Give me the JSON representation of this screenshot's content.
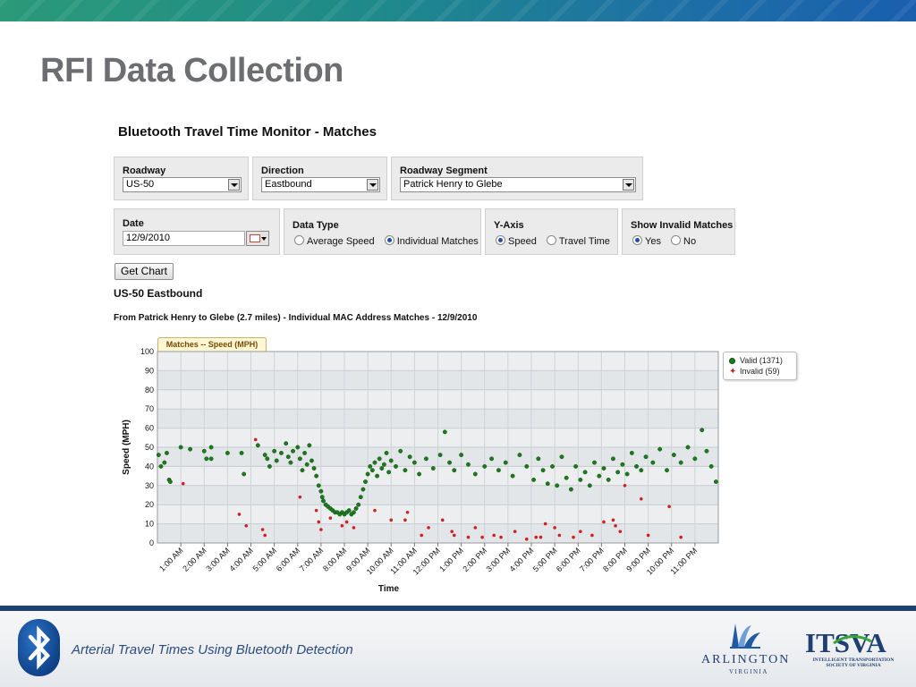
{
  "slide_title": "RFI Data Collection",
  "app_title": "Bluetooth Travel Time Monitor - Matches",
  "form": {
    "roadway": {
      "label": "Roadway",
      "value": "US-50"
    },
    "direction": {
      "label": "Direction",
      "value": "Eastbound"
    },
    "segment": {
      "label": "Roadway Segment",
      "value": "Patrick Henry to Glebe"
    },
    "date": {
      "label": "Date",
      "value": "12/9/2010"
    },
    "data_type": {
      "label": "Data Type",
      "options": [
        "Average Speed",
        "Individual Matches"
      ],
      "selected": "Individual Matches"
    },
    "y_axis": {
      "label": "Y-Axis",
      "options": [
        "Speed",
        "Travel Time"
      ],
      "selected": "Speed"
    },
    "invalid": {
      "label": "Show Invalid Matches",
      "options": [
        "Yes",
        "No"
      ],
      "selected": "Yes"
    },
    "get_chart": "Get Chart"
  },
  "route_title": "US-50 Eastbound",
  "chart_subtitle": "From Patrick Henry to Glebe (2.7 miles) - Individual MAC Address Matches - 12/9/2010",
  "chart_tab": "Matches -- Speed (MPH)",
  "legend": {
    "valid": "Valid (1371)",
    "invalid": "Invalid (59)"
  },
  "chart_data": {
    "type": "scatter",
    "title": "Matches -- Speed (MPH)",
    "xlabel": "Time",
    "ylabel": "Speed (MPH)",
    "xlim": [
      0,
      24
    ],
    "ylim": [
      0,
      100
    ],
    "yticks": [
      0,
      10,
      20,
      30,
      40,
      50,
      60,
      70,
      80,
      90,
      100
    ],
    "xticks": [
      1,
      2,
      3,
      4,
      5,
      6,
      7,
      8,
      9,
      10,
      11,
      12,
      13,
      14,
      15,
      16,
      17,
      18,
      19,
      20,
      21,
      22,
      23
    ],
    "xtick_labels": [
      "1:00 AM",
      "2:00 AM",
      "3:00 AM",
      "4:00 AM",
      "5:00 AM",
      "6:00 AM",
      "7:00 AM",
      "8:00 AM",
      "9:00 AM",
      "10:00 AM",
      "11:00 AM",
      "12:00 PM",
      "1:00 PM",
      "2:00 PM",
      "3:00 PM",
      "4:00 PM",
      "5:00 PM",
      "6:00 PM",
      "7:00 PM",
      "8:00 PM",
      "9:00 PM",
      "10:00 PM",
      "11:00 PM"
    ],
    "grid": true,
    "legend_position": "top-right",
    "series": [
      {
        "name": "Valid (1371)",
        "color": "#1d7a1d",
        "marker": "circle",
        "points": [
          [
            0.05,
            46
          ],
          [
            0.15,
            40
          ],
          [
            0.3,
            42
          ],
          [
            0.4,
            47
          ],
          [
            0.5,
            33
          ],
          [
            0.55,
            32
          ],
          [
            1.0,
            50
          ],
          [
            1.4,
            49
          ],
          [
            2.0,
            48
          ],
          [
            2.1,
            44
          ],
          [
            2.3,
            50
          ],
          [
            2.3,
            44
          ],
          [
            3.0,
            47
          ],
          [
            3.6,
            47
          ],
          [
            3.7,
            36
          ],
          [
            4.3,
            51
          ],
          [
            4.6,
            46
          ],
          [
            4.7,
            44
          ],
          [
            4.8,
            40
          ],
          [
            5.0,
            48
          ],
          [
            5.1,
            43
          ],
          [
            5.3,
            47
          ],
          [
            5.5,
            52
          ],
          [
            5.6,
            45
          ],
          [
            5.7,
            42
          ],
          [
            5.8,
            48
          ],
          [
            6.0,
            50
          ],
          [
            6.1,
            44
          ],
          [
            6.2,
            38
          ],
          [
            6.3,
            47
          ],
          [
            6.4,
            41
          ],
          [
            6.5,
            51
          ],
          [
            6.6,
            43
          ],
          [
            6.7,
            39
          ],
          [
            6.8,
            35
          ],
          [
            6.9,
            30
          ],
          [
            7.0,
            27
          ],
          [
            7.05,
            24
          ],
          [
            7.1,
            22
          ],
          [
            7.2,
            20
          ],
          [
            7.3,
            19
          ],
          [
            7.4,
            18
          ],
          [
            7.5,
            17
          ],
          [
            7.6,
            16
          ],
          [
            7.7,
            16
          ],
          [
            7.8,
            15
          ],
          [
            7.9,
            16
          ],
          [
            8.0,
            15
          ],
          [
            8.1,
            16
          ],
          [
            8.2,
            17
          ],
          [
            8.3,
            15
          ],
          [
            8.4,
            16
          ],
          [
            8.5,
            18
          ],
          [
            8.6,
            20
          ],
          [
            8.7,
            24
          ],
          [
            8.8,
            28
          ],
          [
            8.9,
            32
          ],
          [
            9.0,
            36
          ],
          [
            9.1,
            40
          ],
          [
            9.2,
            38
          ],
          [
            9.3,
            42
          ],
          [
            9.4,
            35
          ],
          [
            9.5,
            44
          ],
          [
            9.6,
            39
          ],
          [
            9.7,
            41
          ],
          [
            9.8,
            47
          ],
          [
            9.9,
            37
          ],
          [
            10.0,
            43
          ],
          [
            10.2,
            40
          ],
          [
            10.4,
            48
          ],
          [
            10.6,
            38
          ],
          [
            10.8,
            45
          ],
          [
            11.0,
            42
          ],
          [
            11.2,
            36
          ],
          [
            11.5,
            44
          ],
          [
            11.8,
            39
          ],
          [
            12.1,
            46
          ],
          [
            12.3,
            58
          ],
          [
            12.5,
            42
          ],
          [
            12.7,
            38
          ],
          [
            13.0,
            46
          ],
          [
            13.3,
            41
          ],
          [
            13.6,
            36
          ],
          [
            14.0,
            40
          ],
          [
            14.3,
            44
          ],
          [
            14.6,
            38
          ],
          [
            14.9,
            42
          ],
          [
            15.2,
            35
          ],
          [
            15.5,
            46
          ],
          [
            15.8,
            40
          ],
          [
            16.1,
            33
          ],
          [
            16.3,
            44
          ],
          [
            16.5,
            38
          ],
          [
            16.7,
            31
          ],
          [
            16.9,
            40
          ],
          [
            17.1,
            30
          ],
          [
            17.3,
            45
          ],
          [
            17.5,
            34
          ],
          [
            17.7,
            28
          ],
          [
            17.9,
            40
          ],
          [
            18.1,
            33
          ],
          [
            18.3,
            37
          ],
          [
            18.5,
            30
          ],
          [
            18.7,
            42
          ],
          [
            18.9,
            35
          ],
          [
            19.1,
            39
          ],
          [
            19.3,
            33
          ],
          [
            19.5,
            44
          ],
          [
            19.7,
            37
          ],
          [
            19.9,
            41
          ],
          [
            20.1,
            36
          ],
          [
            20.3,
            47
          ],
          [
            20.5,
            40
          ],
          [
            20.7,
            38
          ],
          [
            20.9,
            45
          ],
          [
            21.2,
            42
          ],
          [
            21.5,
            49
          ],
          [
            21.8,
            38
          ],
          [
            22.1,
            46
          ],
          [
            22.4,
            42
          ],
          [
            22.7,
            50
          ],
          [
            23.0,
            44
          ],
          [
            23.3,
            59
          ],
          [
            23.5,
            48
          ],
          [
            23.7,
            40
          ],
          [
            23.9,
            32
          ]
        ]
      },
      {
        "name": "Invalid (59)",
        "color": "#cc2222",
        "marker": "star",
        "points": [
          [
            1.1,
            31
          ],
          [
            3.5,
            15
          ],
          [
            3.8,
            9
          ],
          [
            4.2,
            54
          ],
          [
            4.5,
            7
          ],
          [
            4.6,
            4
          ],
          [
            6.1,
            24
          ],
          [
            6.8,
            17
          ],
          [
            6.9,
            11
          ],
          [
            7.0,
            7
          ],
          [
            7.4,
            13
          ],
          [
            7.9,
            9
          ],
          [
            8.1,
            11
          ],
          [
            8.4,
            8
          ],
          [
            9.3,
            17
          ],
          [
            10.0,
            12
          ],
          [
            10.6,
            12
          ],
          [
            10.7,
            16
          ],
          [
            11.3,
            4
          ],
          [
            11.6,
            8
          ],
          [
            12.2,
            12
          ],
          [
            12.6,
            6
          ],
          [
            12.7,
            4
          ],
          [
            13.3,
            3
          ],
          [
            13.6,
            8
          ],
          [
            13.9,
            3
          ],
          [
            14.4,
            4
          ],
          [
            14.7,
            3
          ],
          [
            15.3,
            6
          ],
          [
            15.8,
            2
          ],
          [
            16.2,
            3
          ],
          [
            16.4,
            3
          ],
          [
            16.6,
            10
          ],
          [
            17.0,
            8
          ],
          [
            17.2,
            4
          ],
          [
            17.8,
            3
          ],
          [
            18.1,
            6
          ],
          [
            18.6,
            4
          ],
          [
            19.1,
            11
          ],
          [
            19.5,
            12
          ],
          [
            19.6,
            9
          ],
          [
            19.8,
            6
          ],
          [
            20.0,
            30
          ],
          [
            20.7,
            23
          ],
          [
            21.0,
            4
          ],
          [
            21.9,
            19
          ],
          [
            22.4,
            3
          ]
        ]
      }
    ]
  },
  "footer": {
    "text": "Arterial Travel Times Using Bluetooth Detection"
  },
  "logos": {
    "arlington": "ARLINGTON",
    "arlington_sub": "VIRGINIA",
    "itsva": "ITSVA",
    "itsva_sub": "INTELLIGENT TRANSPORTATION SOCIETY OF VIRGINIA"
  },
  "colors": {
    "accent": "#1e4272",
    "valid": "#1d7a1d",
    "invalid": "#cc2222",
    "title_gray": "#6d6e71"
  },
  "icons": [
    "bluetooth-icon",
    "calendar-icon",
    "chevron-down-icon"
  ]
}
